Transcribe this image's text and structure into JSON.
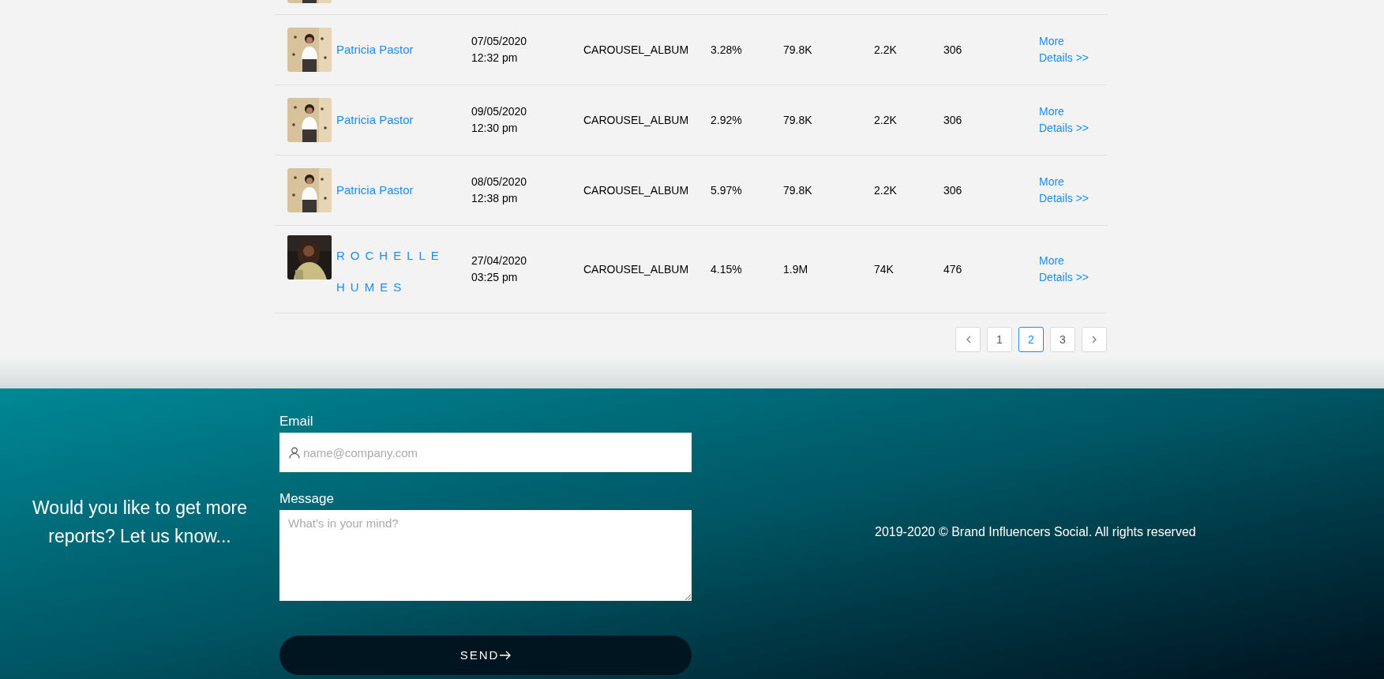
{
  "table": {
    "rows": [
      {
        "name": "Patricia Pastor",
        "kind": "plain",
        "date": "07/05/2020",
        "time": "12:32 pm",
        "type": "CAROUSEL_ALBUM",
        "rate": "3.28%",
        "followers": "79.8K",
        "likes": "2.2K",
        "comments": "306",
        "link": [
          "More",
          "Details >>"
        ]
      },
      {
        "name": "Patricia Pastor",
        "kind": "plain",
        "date": "09/05/2020",
        "time": "12:30 pm",
        "type": "CAROUSEL_ALBUM",
        "rate": "2.92%",
        "followers": "79.8K",
        "likes": "2.2K",
        "comments": "306",
        "link": [
          "More",
          "Details >>"
        ]
      },
      {
        "name": "Patricia Pastor",
        "kind": "plain",
        "date": "08/05/2020",
        "time": "12:38 pm",
        "type": "CAROUSEL_ALBUM",
        "rate": "5.97%",
        "followers": "79.8K",
        "likes": "2.2K",
        "comments": "306",
        "link": [
          "More",
          "Details >>"
        ]
      },
      {
        "name": "ROCHELLEHUMES",
        "kind": "spaced",
        "date": "27/04/2020",
        "time": "03:25 pm",
        "type": "CAROUSEL_ALBUM",
        "rate": "4.15%",
        "followers": "1.9M",
        "likes": "74K",
        "comments": "476",
        "link": [
          "More",
          "Details >>"
        ]
      }
    ]
  },
  "pagination": {
    "pages": [
      {
        "label": "1",
        "selected": false
      },
      {
        "label": "2",
        "selected": true
      },
      {
        "label": "3",
        "selected": false
      }
    ]
  },
  "footer": {
    "prompt": "Would you like to get more reports? Let us know...",
    "email": {
      "label": "Email",
      "placeholder": "name@company.com"
    },
    "message": {
      "label": "Message",
      "placeholder": "What's in your mind?"
    },
    "send": "SEND",
    "copyright": "2019-2020 © Brand Influencers Social. All rights reserved"
  }
}
